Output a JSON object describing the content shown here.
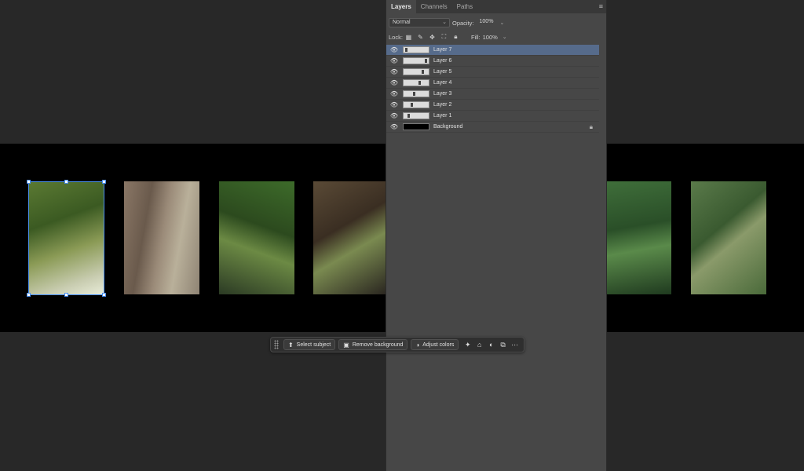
{
  "panel": {
    "tabs": [
      "Layers",
      "Channels",
      "Paths"
    ],
    "menu_icon": "hamburger-menu-icon",
    "blend_mode": "Normal",
    "opacity_label": "Opacity:",
    "opacity_value": "100%",
    "lock_label": "Lock:",
    "fill_label": "Fill:",
    "fill_value": "100%",
    "layers": [
      {
        "name": "Layer 7",
        "active": true
      },
      {
        "name": "Layer 6",
        "active": false
      },
      {
        "name": "Layer 5",
        "active": false
      },
      {
        "name": "Layer 4",
        "active": false
      },
      {
        "name": "Layer 3",
        "active": false
      },
      {
        "name": "Layer 2",
        "active": false
      },
      {
        "name": "Layer 1",
        "active": false
      },
      {
        "name": "Background",
        "active": false,
        "locked": true
      }
    ]
  },
  "taskbar": {
    "select_subject": "Select subject",
    "remove_background": "Remove background",
    "adjust_colors": "Adjust colors"
  },
  "colors": {
    "canvas_bg": "#000000",
    "selection": "#4a8ff0",
    "active_layer": "#566b8b",
    "photo_tones": [
      "#4d6b2a",
      "#7a6a55",
      "#3f6b2e",
      "#5a4a36",
      "#2f5a2a",
      "#4a6a3a"
    ]
  }
}
